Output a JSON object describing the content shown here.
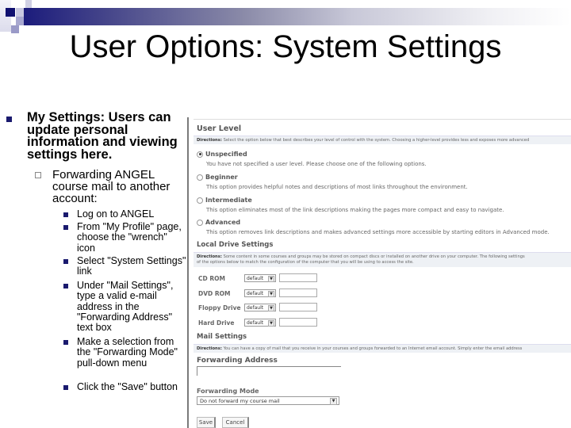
{
  "slide": {
    "title": "User Options: System Settings",
    "colors": {
      "accent": "#1a1a6e",
      "bar_start": "#1c1c7c",
      "bar_end": "#ffffff"
    }
  },
  "bullets": {
    "level1": {
      "bold": "My Settings:",
      "text": " Users can update personal information and viewing settings here."
    },
    "level2": {
      "text": "Forwarding ANGEL course mail to another account:"
    },
    "level3": [
      "Log on to ANGEL",
      "From \"My Profile\" page, choose the \"wrench\" icon",
      "Select \"System Settings\" link",
      "Under \"Mail Settings\", type a valid e-mail address in the \"Forwarding Address\" text box",
      "Make a selection from the \"Forwarding Mode\" pull-down menu",
      "Click the \"Save\" button"
    ]
  },
  "screenshot": {
    "user_level": {
      "heading": "User Level",
      "directions_label": "Directions:",
      "directions": " Select the option below that best describes your level of control with the system. Choosing a higher-level provides less and exposes more advanced",
      "options": [
        {
          "label": "Unspecified",
          "desc": "You have not specified a user level. Please choose one of the following options.",
          "selected": true
        },
        {
          "label": "Beginner",
          "desc": "This option provides helpful notes and descriptions of most links throughout the environment.",
          "selected": false
        },
        {
          "label": "Intermediate",
          "desc": "This option eliminates most of the link descriptions making the pages more compact and easy to navigate.",
          "selected": false
        },
        {
          "label": "Advanced",
          "desc": "This option removes link descriptions and makes advanced settings more accessible by starting editors in Advanced mode.",
          "selected": false
        }
      ]
    },
    "local_drive": {
      "heading": "Local Drive Settings",
      "directions_label": "Directions:",
      "directions": " Some content in some courses and groups may be stored on compact discs or installed on another drive on your computer. The following settings",
      "directions2": "of the options below to match the configuration of the computer that you will be using to access the site.",
      "drives": [
        {
          "label": "CD ROM",
          "value": "default"
        },
        {
          "label": "DVD ROM",
          "value": "default"
        },
        {
          "label": "Floppy Drive",
          "value": "default"
        },
        {
          "label": "Hard Drive",
          "value": "default"
        }
      ]
    },
    "mail": {
      "heading": "Mail Settings",
      "directions_label": "Directions:",
      "directions": " You can have a copy of mail that you receive in your courses and groups forwarded to an Internet email account. Simply enter the email address",
      "forwarding_address_label": "Forwarding Address",
      "forwarding_address_value": "",
      "forwarding_mode_label": "Forwarding Mode",
      "forwarding_mode_value": "Do not forward my course mail",
      "save": "Save",
      "cancel": "Cancel"
    }
  }
}
